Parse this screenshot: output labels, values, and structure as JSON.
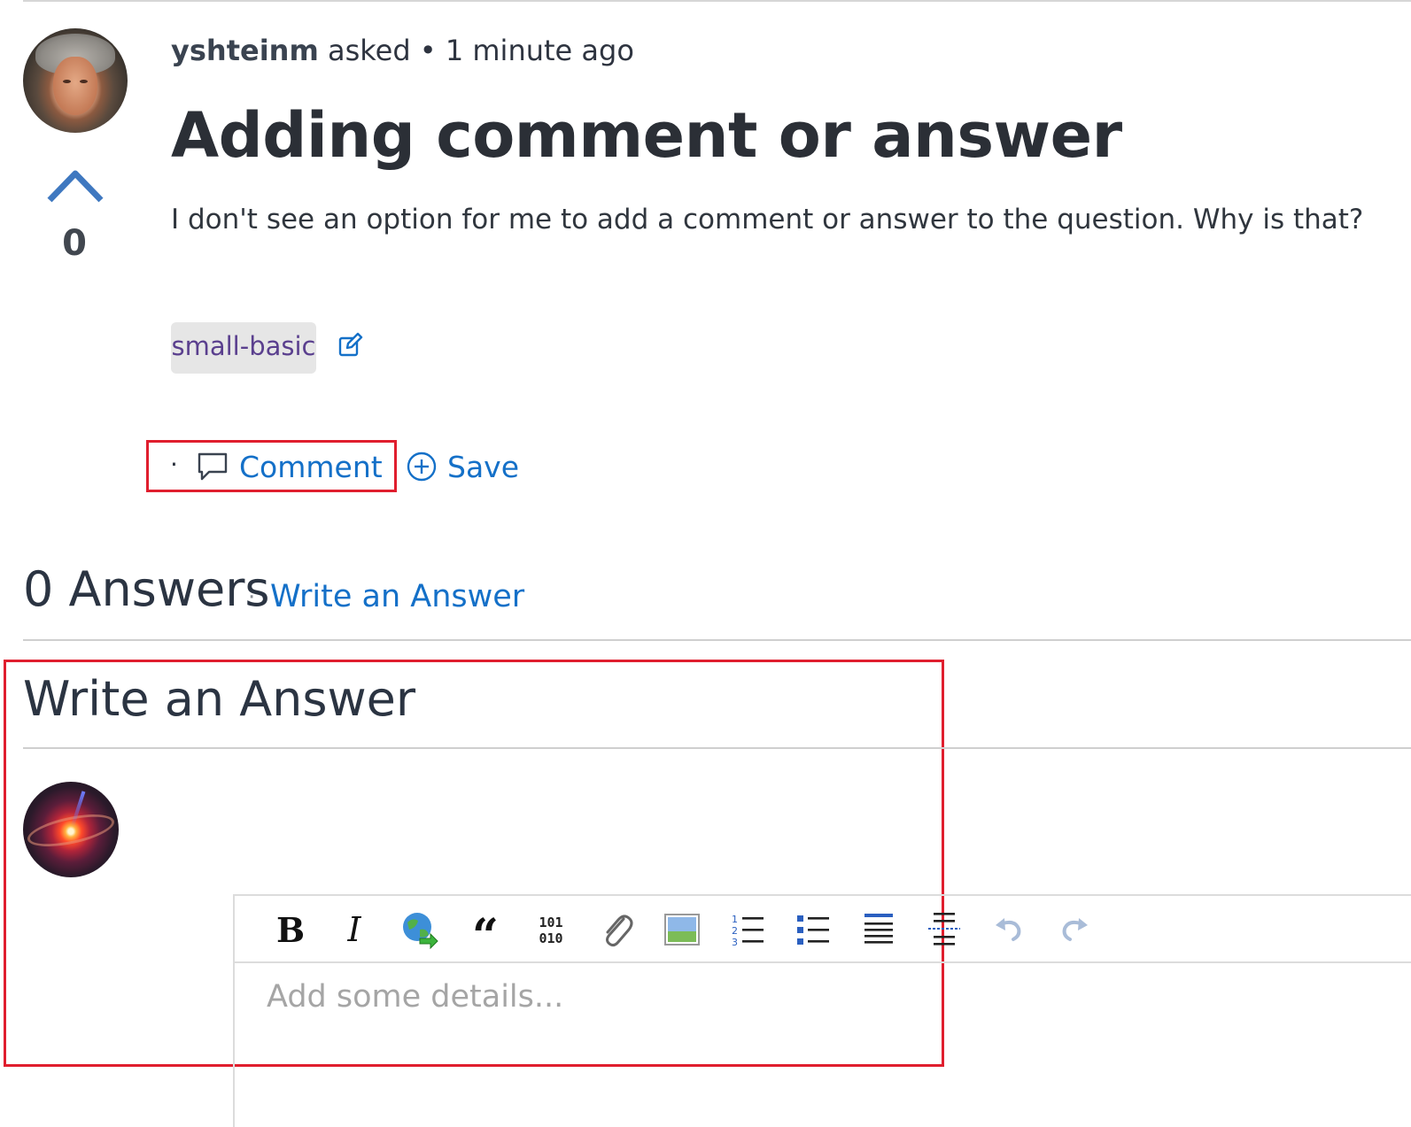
{
  "question": {
    "author": "yshteinm",
    "action": "asked",
    "separator": "•",
    "time": "1 minute ago",
    "title": "Adding comment or answer",
    "body": "I don't see an option for me to add a comment or answer to the question. Why is that?",
    "vote_count": "0",
    "tags": [
      "small-basic"
    ]
  },
  "actions": {
    "dot": "·",
    "comment_label": "Comment",
    "save_label": "Save"
  },
  "answers": {
    "count_label": "0 Answers",
    "separator": "·",
    "write_link": "Write an Answer"
  },
  "write_answer": {
    "heading": "Write an Answer",
    "placeholder": "Add some details..."
  },
  "toolbar_icons": [
    "bold-icon",
    "italic-icon",
    "link-icon",
    "quote-icon",
    "code-icon",
    "attachment-icon",
    "image-icon",
    "numbered-list-icon",
    "bullet-list-icon",
    "align-icon",
    "horizontal-rule-icon",
    "undo-icon",
    "redo-icon"
  ],
  "colors": {
    "link": "#1470c8",
    "highlight": "#e01e2e",
    "tag_text": "#5a3f8e",
    "tag_bg": "#e6e6e6"
  }
}
